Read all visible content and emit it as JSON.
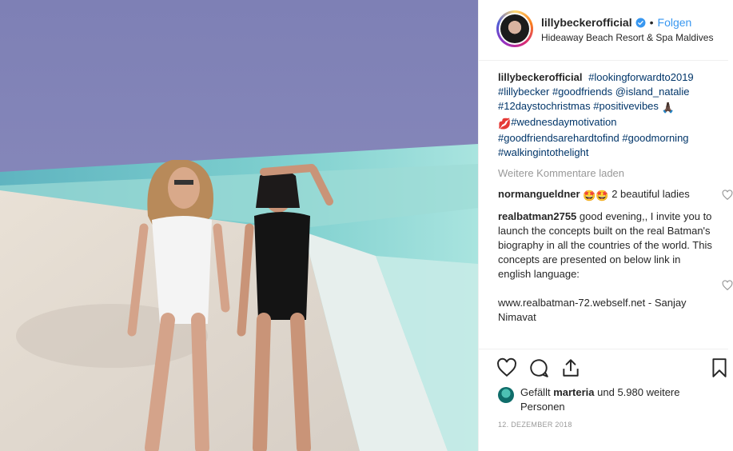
{
  "post": {
    "username": "lillybeckerofficial",
    "separator": "•",
    "follow_label": "Folgen",
    "location": "Hideaway Beach Resort & Spa Maldives"
  },
  "caption": {
    "username": "lillybeckerofficial",
    "line1_tag": "#lookingforwardto2019",
    "line2_tag1": "#lillybecker",
    "line2_tag2": "#goodfriends",
    "line2_mention": "@island_natalie",
    "line3_tag1": "#12daystochristmas",
    "line3_tag2": "#positivevibes",
    "line3_emoji": "🙏🏿",
    "line4_emoji": "💋",
    "line4_tag": "#wednesdaymotivation",
    "line5_tag1": "#goodfriendsarehardtofind",
    "line5_tag2": "#goodmorning",
    "line6_tag": "#walkingintothelight"
  },
  "load_more_label": "Weitere Kommentare laden",
  "comments": [
    {
      "username": "normangueldner",
      "emoji": "🤩🤩",
      "text": "2 beautiful ladies"
    },
    {
      "username": "realbatman2755",
      "text": "good evening,, I invite you to launch the concepts built on the real Batman's biography in all the countries of the world. This concepts are presented on below link in english language:",
      "link_text": "www.realbatman-72.webself.net - Sanjay Nimavat"
    }
  ],
  "likes": {
    "prefix": "Gefällt",
    "user": "marteria",
    "suffix": "und 5.980 weitere Personen"
  },
  "date": "12. Dezember 2018",
  "colors": {
    "link": "#003569",
    "follow": "#3897f0",
    "muted": "#999999"
  },
  "icons": {
    "like": "heart-icon",
    "comment": "comment-icon",
    "share": "share-icon",
    "save": "bookmark-icon",
    "verified": "verified-badge-icon"
  }
}
